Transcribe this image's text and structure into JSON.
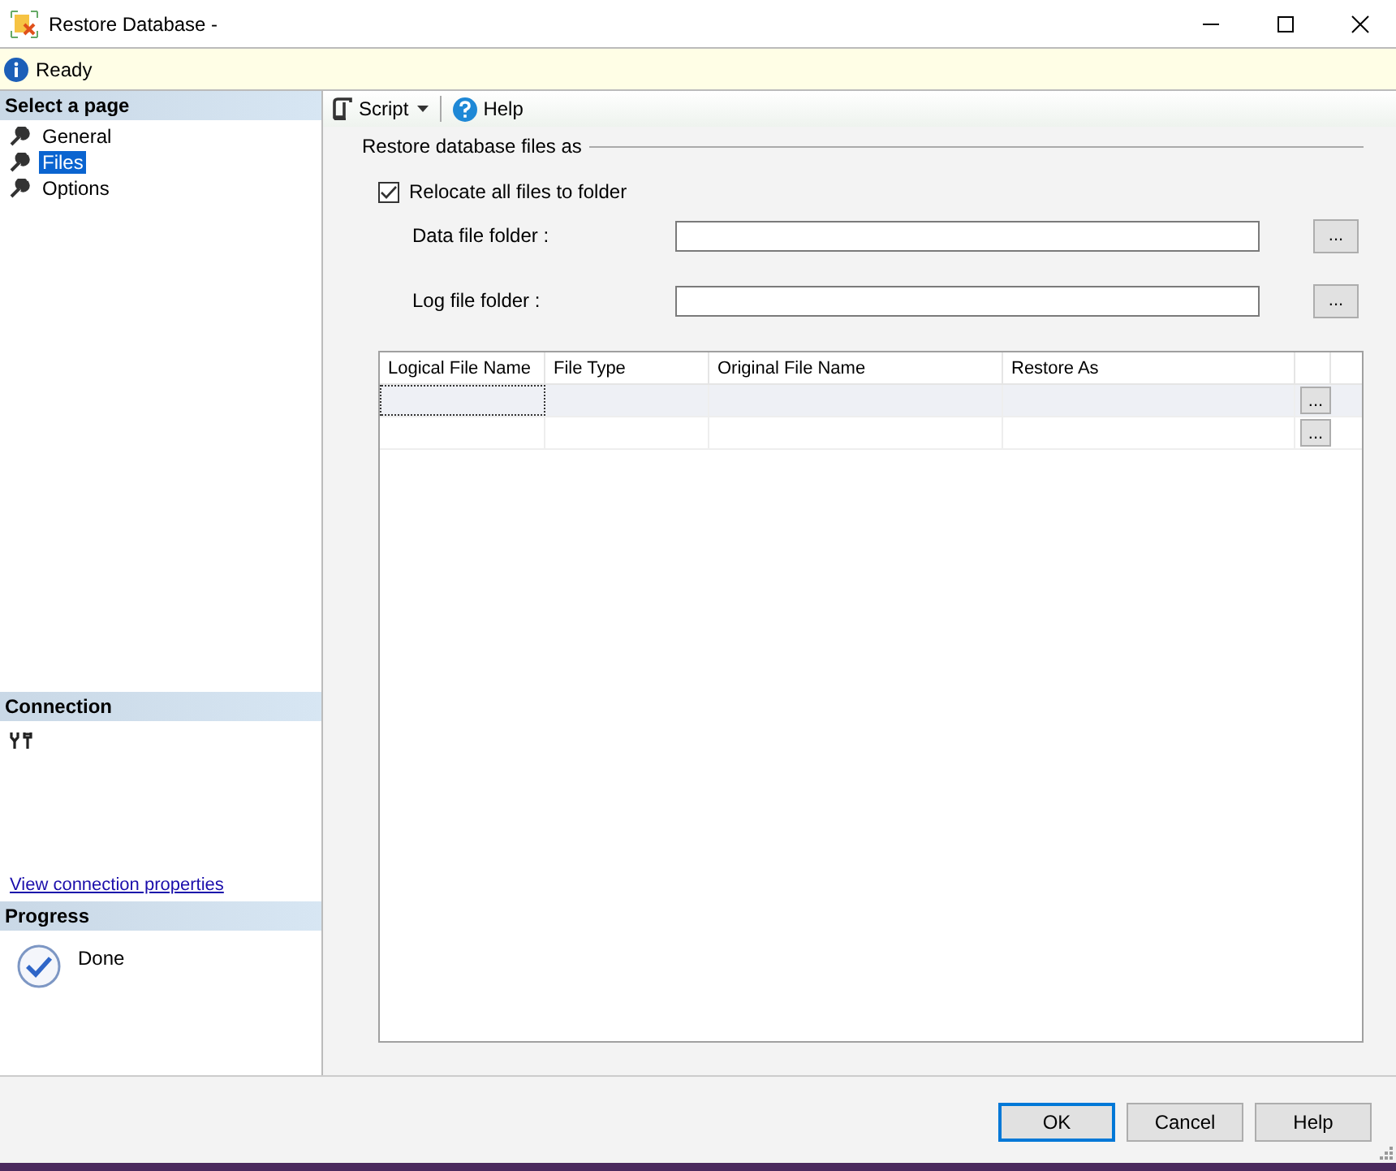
{
  "window": {
    "title": "Restore Database -"
  },
  "status": {
    "text": "Ready"
  },
  "sidebar": {
    "heading": "Select a page",
    "items": [
      {
        "label": "General",
        "selected": false
      },
      {
        "label": "Files",
        "selected": true
      },
      {
        "label": "Options",
        "selected": false
      }
    ]
  },
  "connection": {
    "heading": "Connection",
    "link": "View connection properties"
  },
  "progress": {
    "heading": "Progress",
    "state": "Done"
  },
  "toolbar": {
    "script": "Script",
    "help": "Help"
  },
  "group": {
    "title": "Restore database files as",
    "relocate": {
      "label": "Relocate all files to folder",
      "checked": true
    },
    "fields": [
      {
        "label": "Data file folder :",
        "browse": "..."
      },
      {
        "label": "Log file folder :",
        "browse": "..."
      }
    ]
  },
  "table": {
    "columns": [
      "Logical File Name",
      "File Type",
      "Original File Name",
      "Restore As"
    ],
    "rows": [
      {
        "selected": true,
        "browse": "..."
      },
      {
        "selected": false,
        "browse": "..."
      }
    ]
  },
  "buttons": [
    {
      "label": "OK",
      "default": true
    },
    {
      "label": "Cancel",
      "default": false
    },
    {
      "label": "Help",
      "default": false
    }
  ]
}
